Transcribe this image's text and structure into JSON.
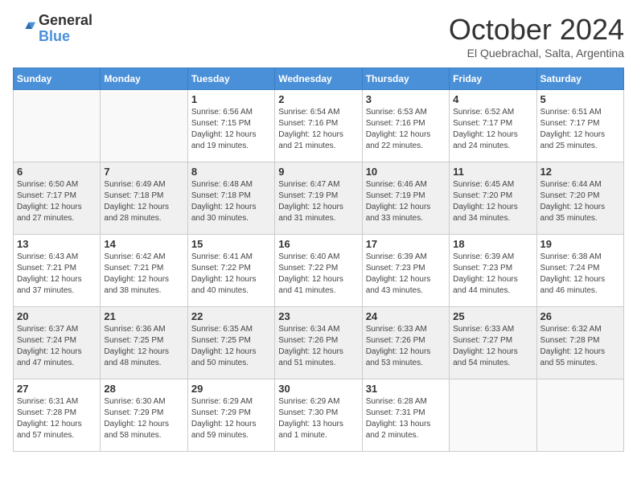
{
  "header": {
    "logo_general": "General",
    "logo_blue": "Blue",
    "title": "October 2024",
    "subtitle": "El Quebrachal, Salta, Argentina"
  },
  "days_of_week": [
    "Sunday",
    "Monday",
    "Tuesday",
    "Wednesday",
    "Thursday",
    "Friday",
    "Saturday"
  ],
  "weeks": [
    [
      {
        "day": "",
        "info": ""
      },
      {
        "day": "",
        "info": ""
      },
      {
        "day": "1",
        "info": "Sunrise: 6:56 AM\nSunset: 7:15 PM\nDaylight: 12 hours and 19 minutes."
      },
      {
        "day": "2",
        "info": "Sunrise: 6:54 AM\nSunset: 7:16 PM\nDaylight: 12 hours and 21 minutes."
      },
      {
        "day": "3",
        "info": "Sunrise: 6:53 AM\nSunset: 7:16 PM\nDaylight: 12 hours and 22 minutes."
      },
      {
        "day": "4",
        "info": "Sunrise: 6:52 AM\nSunset: 7:17 PM\nDaylight: 12 hours and 24 minutes."
      },
      {
        "day": "5",
        "info": "Sunrise: 6:51 AM\nSunset: 7:17 PM\nDaylight: 12 hours and 25 minutes."
      }
    ],
    [
      {
        "day": "6",
        "info": "Sunrise: 6:50 AM\nSunset: 7:17 PM\nDaylight: 12 hours and 27 minutes."
      },
      {
        "day": "7",
        "info": "Sunrise: 6:49 AM\nSunset: 7:18 PM\nDaylight: 12 hours and 28 minutes."
      },
      {
        "day": "8",
        "info": "Sunrise: 6:48 AM\nSunset: 7:18 PM\nDaylight: 12 hours and 30 minutes."
      },
      {
        "day": "9",
        "info": "Sunrise: 6:47 AM\nSunset: 7:19 PM\nDaylight: 12 hours and 31 minutes."
      },
      {
        "day": "10",
        "info": "Sunrise: 6:46 AM\nSunset: 7:19 PM\nDaylight: 12 hours and 33 minutes."
      },
      {
        "day": "11",
        "info": "Sunrise: 6:45 AM\nSunset: 7:20 PM\nDaylight: 12 hours and 34 minutes."
      },
      {
        "day": "12",
        "info": "Sunrise: 6:44 AM\nSunset: 7:20 PM\nDaylight: 12 hours and 35 minutes."
      }
    ],
    [
      {
        "day": "13",
        "info": "Sunrise: 6:43 AM\nSunset: 7:21 PM\nDaylight: 12 hours and 37 minutes."
      },
      {
        "day": "14",
        "info": "Sunrise: 6:42 AM\nSunset: 7:21 PM\nDaylight: 12 hours and 38 minutes."
      },
      {
        "day": "15",
        "info": "Sunrise: 6:41 AM\nSunset: 7:22 PM\nDaylight: 12 hours and 40 minutes."
      },
      {
        "day": "16",
        "info": "Sunrise: 6:40 AM\nSunset: 7:22 PM\nDaylight: 12 hours and 41 minutes."
      },
      {
        "day": "17",
        "info": "Sunrise: 6:39 AM\nSunset: 7:23 PM\nDaylight: 12 hours and 43 minutes."
      },
      {
        "day": "18",
        "info": "Sunrise: 6:39 AM\nSunset: 7:23 PM\nDaylight: 12 hours and 44 minutes."
      },
      {
        "day": "19",
        "info": "Sunrise: 6:38 AM\nSunset: 7:24 PM\nDaylight: 12 hours and 46 minutes."
      }
    ],
    [
      {
        "day": "20",
        "info": "Sunrise: 6:37 AM\nSunset: 7:24 PM\nDaylight: 12 hours and 47 minutes."
      },
      {
        "day": "21",
        "info": "Sunrise: 6:36 AM\nSunset: 7:25 PM\nDaylight: 12 hours and 48 minutes."
      },
      {
        "day": "22",
        "info": "Sunrise: 6:35 AM\nSunset: 7:25 PM\nDaylight: 12 hours and 50 minutes."
      },
      {
        "day": "23",
        "info": "Sunrise: 6:34 AM\nSunset: 7:26 PM\nDaylight: 12 hours and 51 minutes."
      },
      {
        "day": "24",
        "info": "Sunrise: 6:33 AM\nSunset: 7:26 PM\nDaylight: 12 hours and 53 minutes."
      },
      {
        "day": "25",
        "info": "Sunrise: 6:33 AM\nSunset: 7:27 PM\nDaylight: 12 hours and 54 minutes."
      },
      {
        "day": "26",
        "info": "Sunrise: 6:32 AM\nSunset: 7:28 PM\nDaylight: 12 hours and 55 minutes."
      }
    ],
    [
      {
        "day": "27",
        "info": "Sunrise: 6:31 AM\nSunset: 7:28 PM\nDaylight: 12 hours and 57 minutes."
      },
      {
        "day": "28",
        "info": "Sunrise: 6:30 AM\nSunset: 7:29 PM\nDaylight: 12 hours and 58 minutes."
      },
      {
        "day": "29",
        "info": "Sunrise: 6:29 AM\nSunset: 7:29 PM\nDaylight: 12 hours and 59 minutes."
      },
      {
        "day": "30",
        "info": "Sunrise: 6:29 AM\nSunset: 7:30 PM\nDaylight: 13 hours and 1 minute."
      },
      {
        "day": "31",
        "info": "Sunrise: 6:28 AM\nSunset: 7:31 PM\nDaylight: 13 hours and 2 minutes."
      },
      {
        "day": "",
        "info": ""
      },
      {
        "day": "",
        "info": ""
      }
    ]
  ]
}
